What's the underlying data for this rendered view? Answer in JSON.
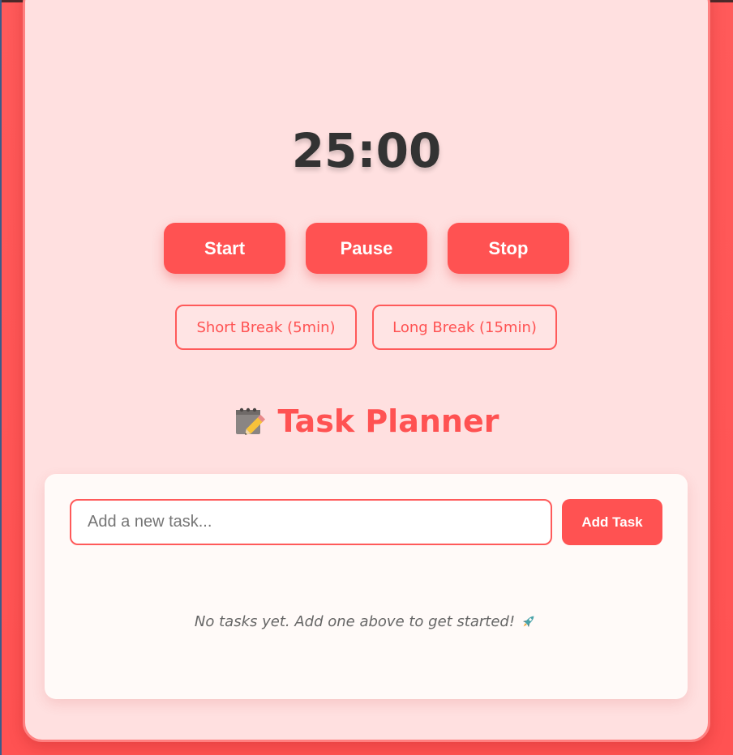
{
  "timer": {
    "display": "25:00"
  },
  "controls": {
    "start_label": "Start",
    "pause_label": "Pause",
    "stop_label": "Stop"
  },
  "breaks": {
    "short_label": "Short Break (5min)",
    "long_label": "Long Break (15min)"
  },
  "planner": {
    "icon": "memo-pencil-icon",
    "title": "Task Planner",
    "input_placeholder": "Add a new task...",
    "input_value": "",
    "add_label": "Add Task",
    "empty_message": "No tasks yet. Add one above to get started!",
    "empty_icon": "rocket-icon"
  },
  "colors": {
    "accent": "#ff5252",
    "background": "#ff5a5a",
    "card": "#ffe0e0",
    "panel": "#fffaf8",
    "timer_text": "#333333"
  }
}
